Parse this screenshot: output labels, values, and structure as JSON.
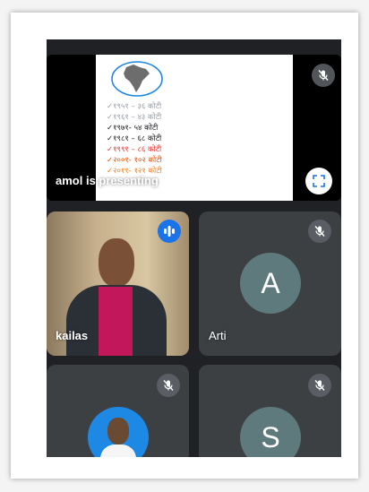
{
  "presentation": {
    "presenter_label": "amol is presenting",
    "lines": [
      {
        "text": "✓१९५१ – ३६ कोटी",
        "color": "#9aa0a6"
      },
      {
        "text": "✓१९६१ – ४३ कोटी",
        "color": "#9aa0a6"
      },
      {
        "text": "✓१९७१- ५४ कोटी",
        "color": "#202124"
      },
      {
        "text": "✓१९८१ – ६८ कोटी",
        "color": "#202124"
      },
      {
        "text": "✓१९९१ – ८६ कोटी",
        "color": "#e53935"
      },
      {
        "text": "✓२००१- १०२ कोटी",
        "color": "#e65100"
      },
      {
        "text": "✓२०११- १२१ कोटी",
        "color": "#f57f17"
      }
    ]
  },
  "participants": [
    {
      "name": "kailas",
      "audio": "speaking"
    },
    {
      "name": "Arti",
      "initial": "A",
      "audio": "muted",
      "avatar_color": "#5f7a7d"
    },
    {
      "name": "",
      "audio": "muted",
      "avatar": "photo"
    },
    {
      "name": "",
      "initial": "S",
      "audio": "muted",
      "avatar_color": "#5f7a7d"
    }
  ],
  "colors": {
    "background": "#202124",
    "tile": "#3c4043",
    "speaking": "#1a73e8",
    "fullscreen_button": "#ffffff"
  }
}
